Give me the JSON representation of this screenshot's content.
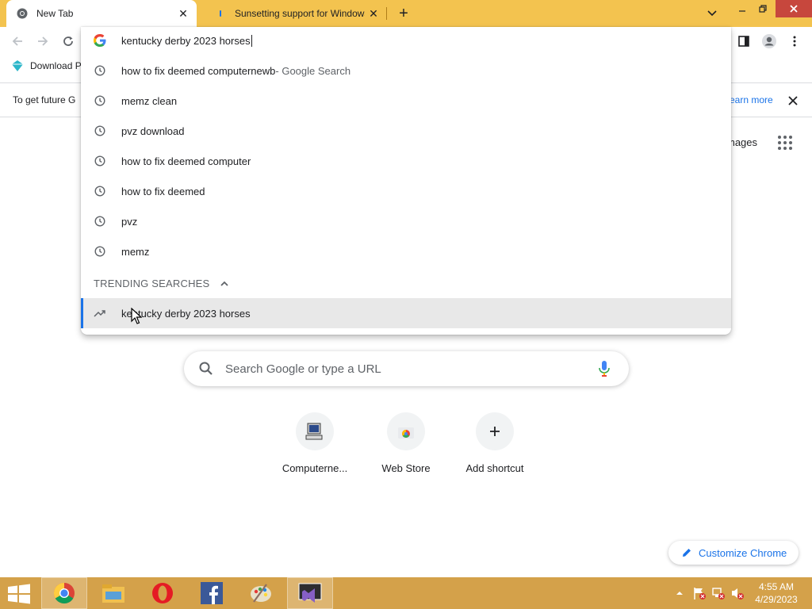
{
  "tabs": [
    {
      "title": "New Tab",
      "active": true
    },
    {
      "title": "Sunsetting support for Windows",
      "active": false
    }
  ],
  "bookmarks": [
    {
      "label": "Download P"
    }
  ],
  "infobar": {
    "text": "To get future G",
    "link": "earn more"
  },
  "omnibox": {
    "value": "kentucky derby 2023 horses"
  },
  "suggestions": [
    {
      "text": "how to fix deemed computernewb",
      "sub": " - Google Search",
      "icon": "history-icon"
    },
    {
      "text": "memz clean",
      "sub": "",
      "icon": "history-icon"
    },
    {
      "text": "pvz download",
      "sub": "",
      "icon": "history-icon"
    },
    {
      "text": "how to fix deemed computer",
      "sub": "",
      "icon": "history-icon"
    },
    {
      "text": "how to fix deemed",
      "sub": "",
      "icon": "history-icon"
    },
    {
      "text": "pvz",
      "sub": "",
      "icon": "history-icon"
    },
    {
      "text": "memz",
      "sub": "",
      "icon": "history-icon"
    }
  ],
  "trending": {
    "header": "TRENDING SEARCHES",
    "items": [
      {
        "text": "kentucky derby 2023 horses",
        "icon": "trending-icon"
      }
    ]
  },
  "ntp": {
    "images_link": "mages",
    "search_placeholder": "Search Google or type a URL",
    "shortcuts": [
      {
        "label": "Computerne...",
        "icon": "computer-icon"
      },
      {
        "label": "Web Store",
        "icon": "webstore-icon"
      },
      {
        "label": "Add shortcut",
        "icon": "plus-icon"
      }
    ],
    "customize_label": "Customize Chrome"
  },
  "taskbar": {
    "apps": [
      "Chrome",
      "File Explorer",
      "Opera",
      "Facebook",
      "Paint",
      "Visual Studio"
    ],
    "time": "4:55 AM",
    "date": "4/29/2023"
  },
  "colors": {
    "titlebar": "#f3c34f",
    "taskbar": "#d4a14a",
    "accent": "#1a73e8"
  }
}
